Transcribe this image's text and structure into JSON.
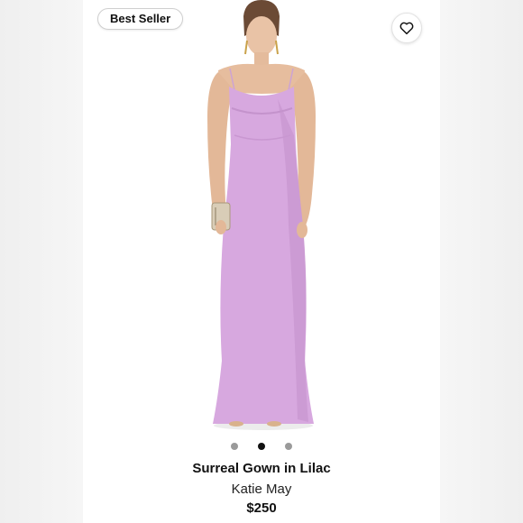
{
  "badge": {
    "label": "Best Seller"
  },
  "product": {
    "title": "Surreal Gown in Lilac",
    "brand": "Katie May",
    "price": "$250"
  },
  "carousel": {
    "total": 3,
    "active_index": 1
  },
  "icons": {
    "favorite": "heart-icon"
  },
  "colors": {
    "gown": "#d7a8df",
    "accent": "#111111",
    "background": "#ffffff"
  }
}
